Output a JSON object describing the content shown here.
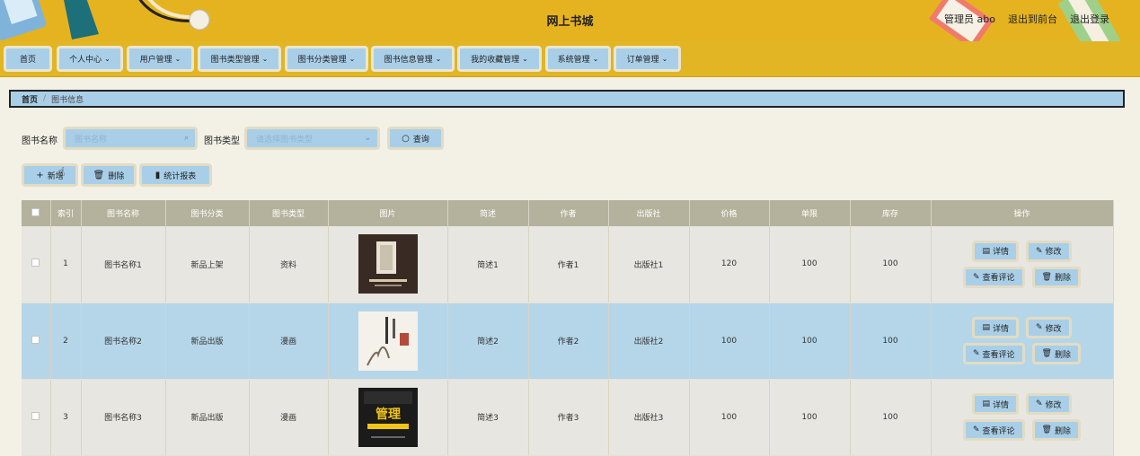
{
  "header": {
    "title": "网上书城",
    "user_label": "管理员 abo",
    "to_front_label": "退出到前台",
    "logout_label": "退出登录"
  },
  "nav": [
    {
      "label": "首页",
      "dropdown": false
    },
    {
      "label": "个人中心",
      "dropdown": true
    },
    {
      "label": "用户管理",
      "dropdown": true
    },
    {
      "label": "图书类型管理",
      "dropdown": true
    },
    {
      "label": "图书分类管理",
      "dropdown": true
    },
    {
      "label": "图书信息管理",
      "dropdown": true
    },
    {
      "label": "我的收藏管理",
      "dropdown": true
    },
    {
      "label": "系统管理",
      "dropdown": true
    },
    {
      "label": "订单管理",
      "dropdown": true
    }
  ],
  "breadcrumb": {
    "home": "首页",
    "separator": "/",
    "current": "图书信息"
  },
  "search": {
    "name_label": "图书名称",
    "name_placeholder": "图书名称",
    "type_label": "图书类型",
    "type_placeholder": "请选择图书类型",
    "query_label": "查询"
  },
  "actions": {
    "add_label": "新增",
    "delete_label": "删除",
    "report_label": "统计报表"
  },
  "table": {
    "columns": [
      "索引",
      "图书名称",
      "图书分类",
      "图书类型",
      "图片",
      "简述",
      "作者",
      "出版社",
      "价格",
      "单限",
      "库存",
      "操作"
    ],
    "row_actions": {
      "detail": "详情",
      "edit": "修改",
      "comments": "查看评论",
      "delete": "删除"
    },
    "rows": [
      {
        "index": "1",
        "name": "图书名称1",
        "category": "新品上架",
        "type": "资料",
        "summary": "简述1",
        "author": "作者1",
        "publisher": "出版社1",
        "price": "120",
        "limit": "100",
        "stock": "100"
      },
      {
        "index": "2",
        "name": "图书名称2",
        "category": "新品出版",
        "type": "漫画",
        "summary": "简述2",
        "author": "作者2",
        "publisher": "出版社2",
        "price": "100",
        "limit": "100",
        "stock": "100"
      },
      {
        "index": "3",
        "name": "图书名称3",
        "category": "新品出版",
        "type": "漫画",
        "summary": "简述3",
        "author": "作者3",
        "publisher": "出版社3",
        "price": "100",
        "limit": "100",
        "stock": "100"
      }
    ]
  },
  "cover3_text": "管理",
  "colors": {
    "header": "#e5b31f",
    "accent": "#a9cfe8",
    "table_head": "#b4b29c",
    "page_bg": "#f3f0e6"
  }
}
